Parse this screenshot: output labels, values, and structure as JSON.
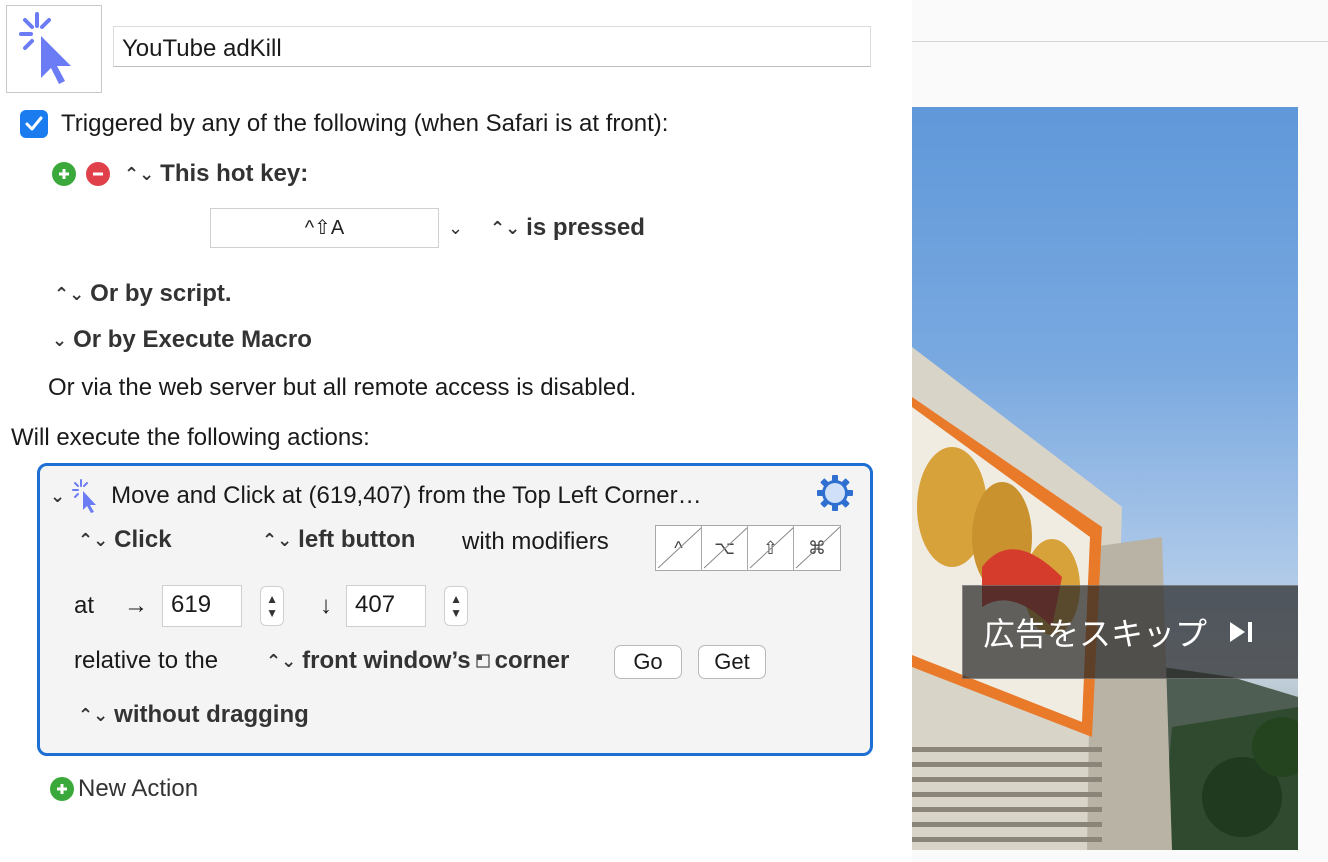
{
  "macro": {
    "name": "YouTube adKill"
  },
  "trigger": {
    "text": "Triggered by any of the following (when Safari is at front):",
    "hotkey_label": "This hot key:",
    "hotkey_value": "^⇧A",
    "hotkey_state": "is pressed",
    "script_label": "Or by script.",
    "execute_macro_label": "Or by Execute Macro",
    "web_server_text": "Or via the web server but all remote access is disabled."
  },
  "actions": {
    "heading": "Will execute the following actions:",
    "card": {
      "title": "Move and Click at (619,407) from the Top Left Corner…",
      "click_type": "Click",
      "button": "left button",
      "modifiers_label": "with modifiers",
      "modifiers": [
        "^",
        "⌥",
        "⇧",
        "⌘"
      ],
      "at_label": "at",
      "x_arrow": "→",
      "x_value": "619",
      "y_arrow": "↓",
      "y_value": "407",
      "relative_label": "relative to the",
      "relative_value": "front window’s",
      "corner_label": "corner",
      "go_button": "Go",
      "get_button": "Get",
      "drag_option": "without dragging"
    },
    "new_action_label": "New Action"
  },
  "video": {
    "skip_label": "広告をスキップ",
    "skip_icon": "skip-next-icon"
  },
  "colors": {
    "accent": "#1d6fd4",
    "checkbox": "#1b7cf0",
    "plus": "#3aa83a",
    "minus": "#e0404a"
  }
}
